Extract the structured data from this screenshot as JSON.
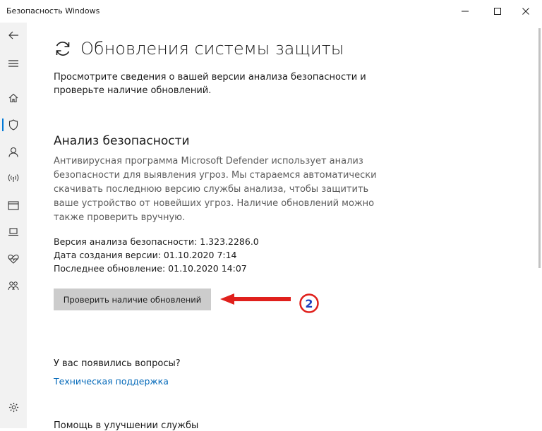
{
  "window": {
    "title": "Безопасность Windows",
    "minimize_glyph": "—",
    "maximize_glyph": "☐",
    "close_glyph": "✕"
  },
  "sidebar": {
    "items": [
      {
        "name": "back",
        "icon": "back-arrow-icon"
      },
      {
        "name": "menu",
        "icon": "hamburger-icon"
      },
      {
        "name": "home",
        "icon": "home-icon"
      },
      {
        "name": "virus-protection",
        "icon": "shield-icon",
        "active": true
      },
      {
        "name": "account-protection",
        "icon": "person-icon"
      },
      {
        "name": "firewall",
        "icon": "wireless-icon"
      },
      {
        "name": "app-browser-control",
        "icon": "browser-window-icon"
      },
      {
        "name": "device-security",
        "icon": "laptop-icon"
      },
      {
        "name": "device-performance",
        "icon": "heart-pulse-icon"
      },
      {
        "name": "family-options",
        "icon": "family-icon"
      },
      {
        "name": "settings",
        "icon": "gear-icon"
      }
    ],
    "accent_color": "#0078d7"
  },
  "main": {
    "title": "Обновления системы защиты",
    "title_icon": "refresh-icon",
    "intro": "Просмотрите сведения о вашей версии анализа безопасности и проверьте наличие обновлений.",
    "section": {
      "heading": "Анализ безопасности",
      "description": "Антивирусная программа Microsoft Defender использует анализ безопасности для выявления угроз. Мы стараемся автоматически скачивать последнюю версию службы анализа, чтобы защитить ваше устройство от новейших угроз. Наличие обновлений можно также проверить вручную.",
      "version": "Версия анализа безопасности: 1.323.2286.0",
      "created": "Дата создания версии: 01.10.2020 7:14",
      "last_update": "Последнее обновление: 01.10.2020 14:07",
      "check_button": "Проверить наличие обновлений"
    },
    "questions": {
      "heading": "У вас появились вопросы?",
      "link": "Техническая поддержка",
      "link_color": "#0067b8"
    },
    "next_heading": "Помощь в улучшении службы"
  },
  "annotation": {
    "number": "2",
    "color": "#e0201c"
  }
}
